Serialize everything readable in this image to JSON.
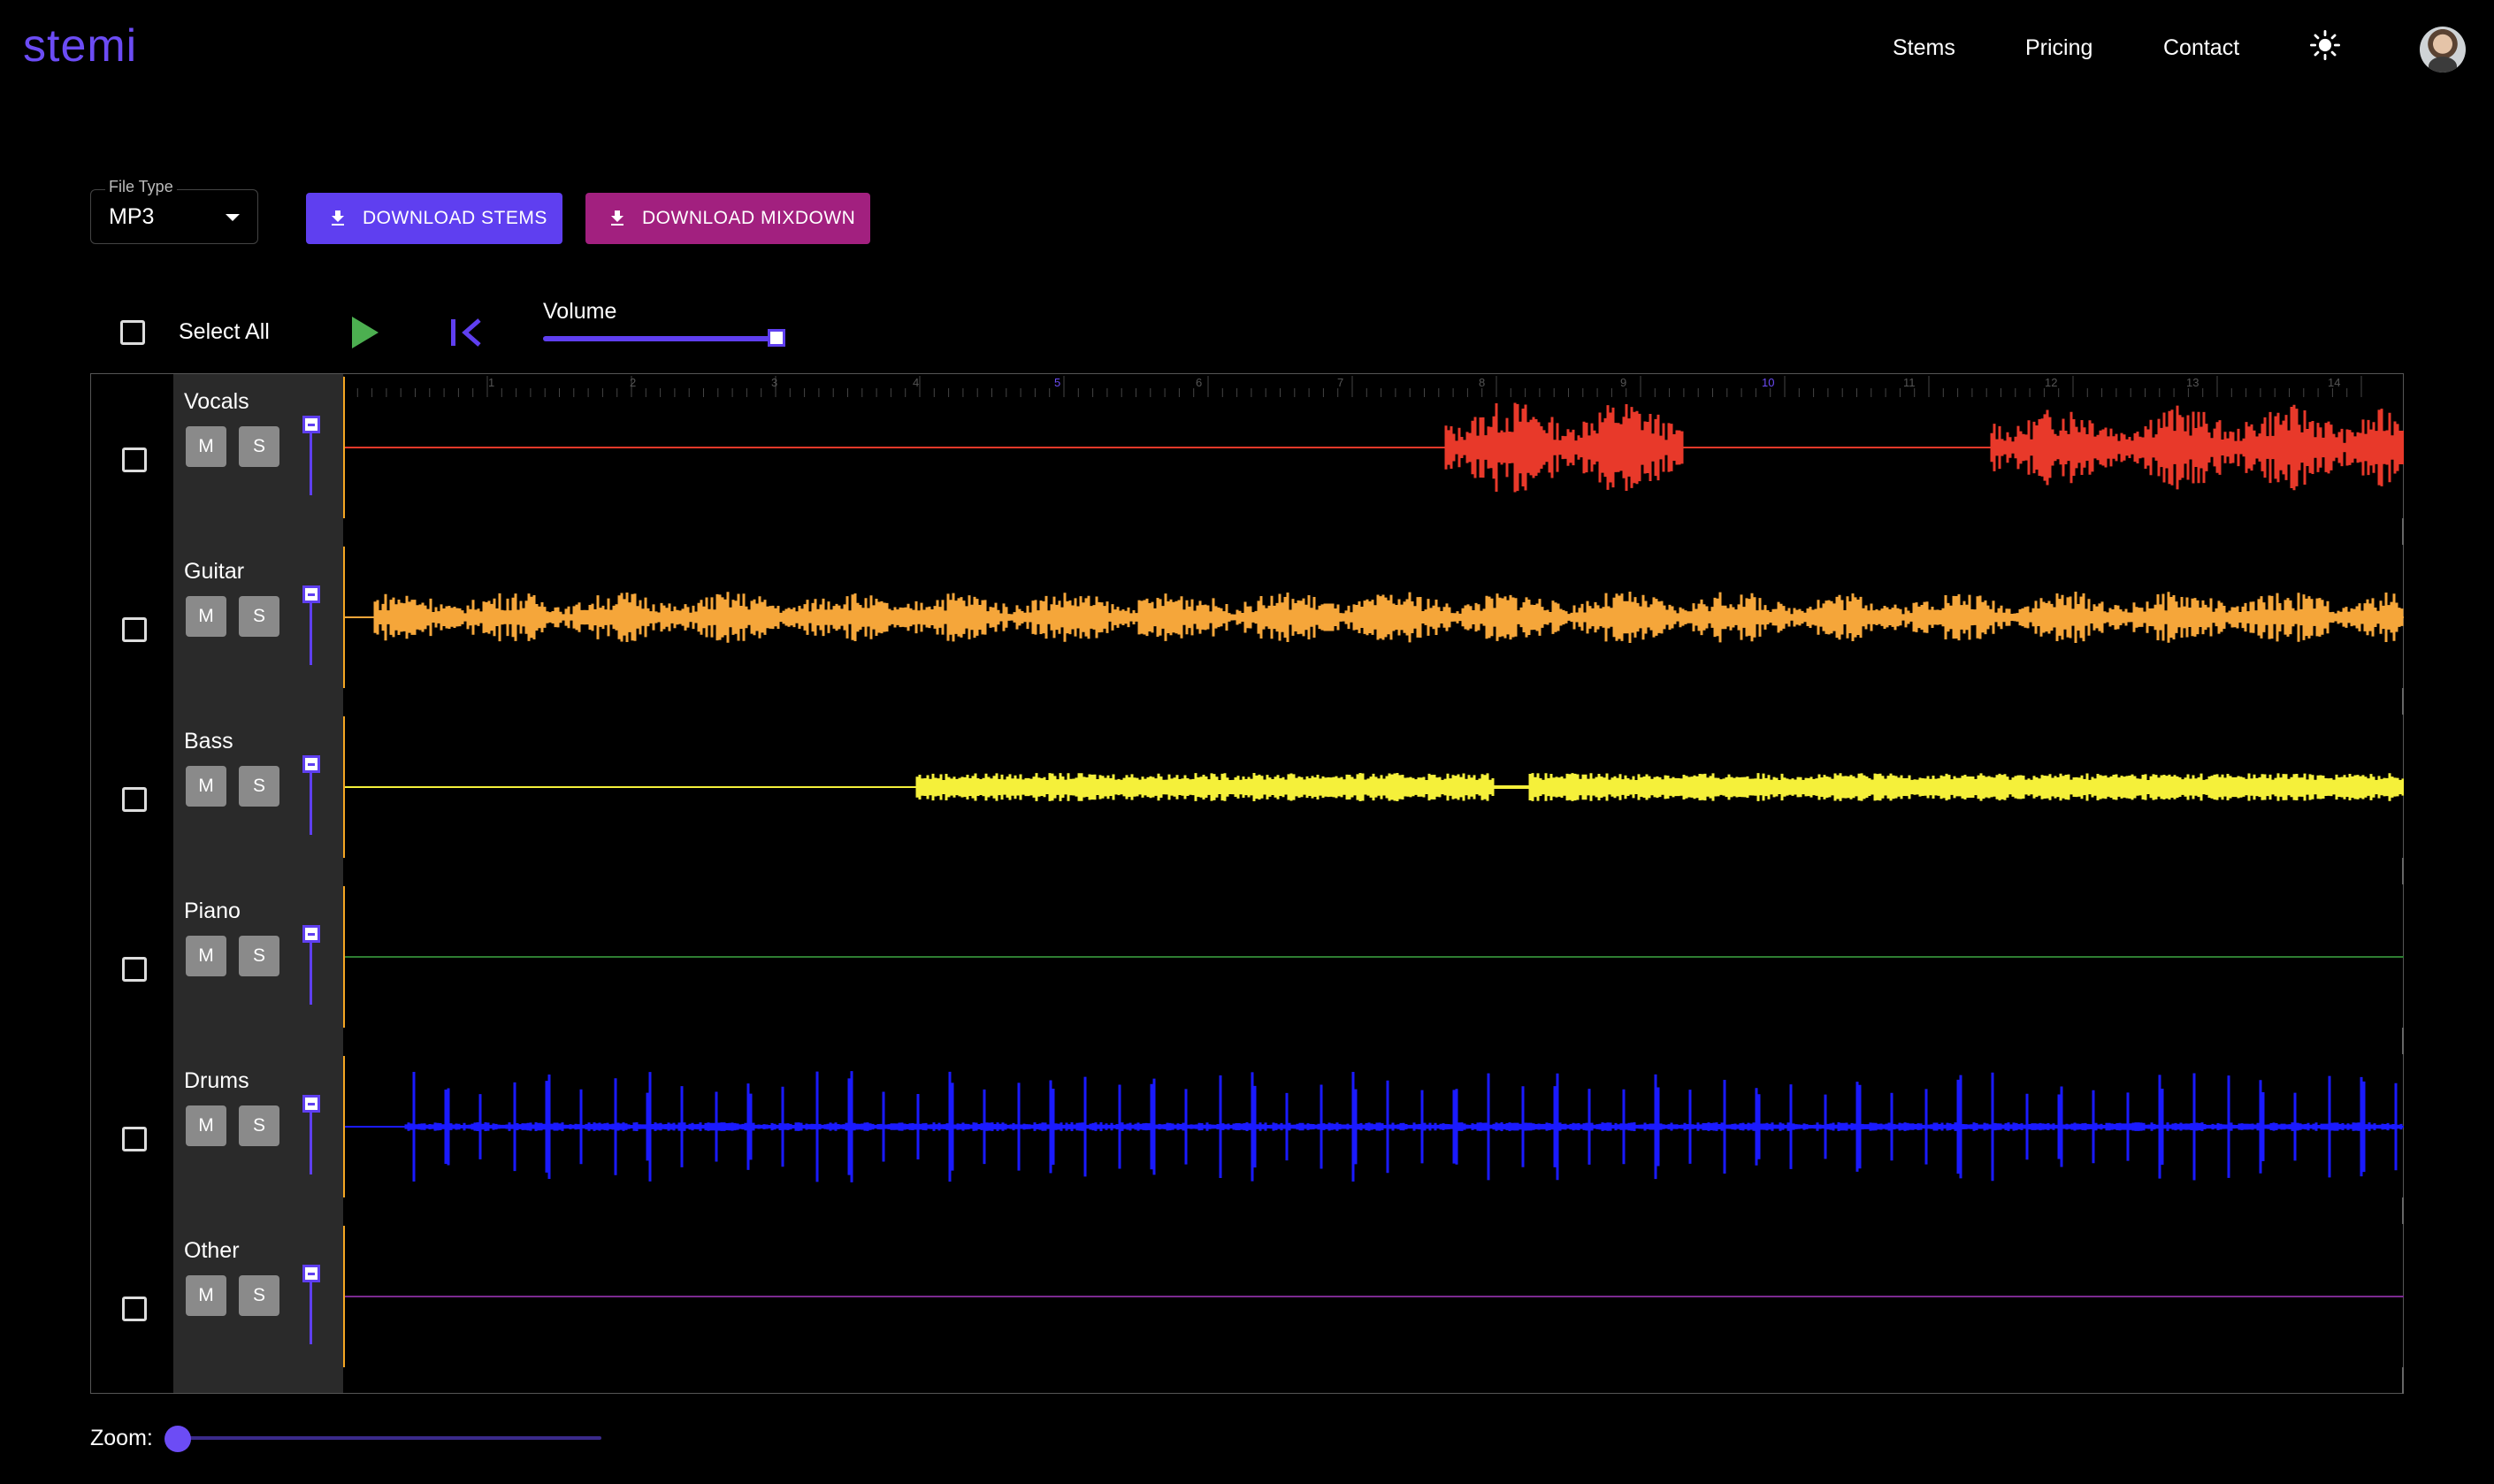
{
  "app": {
    "logo": "stemi"
  },
  "nav": {
    "items": [
      "Stems",
      "Pricing",
      "Contact"
    ],
    "theme_icon": "sun-icon",
    "avatar_icon": "user-avatar"
  },
  "toolbar": {
    "file_type_label": "File Type",
    "file_type_value": "MP3",
    "download_stems": "DOWNLOAD STEMS",
    "download_mixdown": "DOWNLOAD MIXDOWN",
    "download_icon": "download-icon"
  },
  "transport": {
    "select_all": "Select All",
    "play_icon": "play-icon",
    "rewind_icon": "skip-to-start-icon",
    "volume_label": "Volume",
    "volume_level": 1.0
  },
  "timeline": {
    "ticks": [
      "1",
      "2",
      "3",
      "4",
      "5",
      "6",
      "7",
      "8",
      "9",
      "10",
      "11",
      "12",
      "13",
      "14"
    ]
  },
  "tracks": [
    {
      "name": "Vocals",
      "color": "#e8392a",
      "mute": "M",
      "solo": "S"
    },
    {
      "name": "Guitar",
      "color": "#f5a63a",
      "mute": "M",
      "solo": "S"
    },
    {
      "name": "Bass",
      "color": "#f5f03a",
      "mute": "M",
      "solo": "S"
    },
    {
      "name": "Piano",
      "color": "#2e7d32",
      "mute": "M",
      "solo": "S"
    },
    {
      "name": "Drums",
      "color": "#1a1aff",
      "mute": "M",
      "solo": "S"
    },
    {
      "name": "Other",
      "color": "#7b2a8f",
      "mute": "M",
      "solo": "S"
    }
  ],
  "zoom": {
    "label": "Zoom:",
    "level": 0.0
  }
}
